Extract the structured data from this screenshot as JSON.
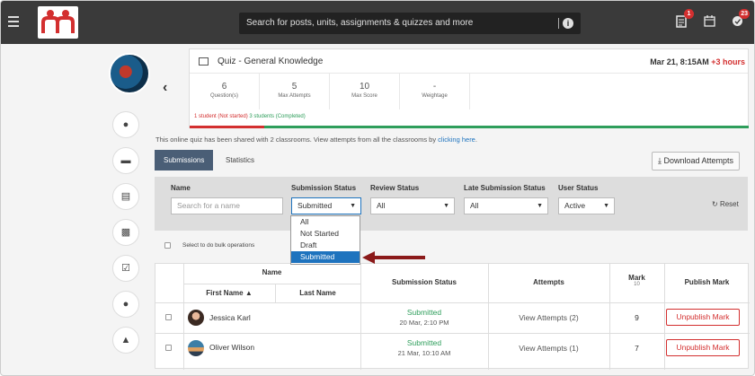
{
  "colors": {
    "accent": "#4a5e76",
    "danger": "#d32f2f",
    "success": "#2e9e5b",
    "link": "#1e73be"
  },
  "topbar": {
    "search_placeholder": "Search for posts, units, assignments & quizzes and more",
    "notifications_count": "1",
    "alerts_count": "23"
  },
  "quiz": {
    "title": "Quiz - General Knowledge",
    "date": "Mar 21, 8:15AM",
    "extra_hours": "+3 hours",
    "stats": [
      {
        "value": "6",
        "label": "Question(s)"
      },
      {
        "value": "5",
        "label": "Max Attempts"
      },
      {
        "value": "10",
        "label": "Max Score"
      },
      {
        "value": "-",
        "label": "Weightage"
      }
    ],
    "not_started": "1 student (Not started)",
    "completed": "3 students (Completed)",
    "progress_fraction": 0.25
  },
  "shared": {
    "text": "This online quiz has been shared with 2 classrooms. View attempts from all the classrooms by ",
    "link": "clicking here",
    "end": "."
  },
  "tabs": {
    "submissions": "Submissions",
    "statistics": "Statistics"
  },
  "download_label": "Download Attempts",
  "filters": {
    "name_label": "Name",
    "name_placeholder": "Search for a name",
    "submission_label": "Submission Status",
    "submission_value": "Submitted",
    "review_label": "Review Status",
    "review_value": "All",
    "late_label": "Late Submission Status",
    "late_value": "All",
    "user_label": "User Status",
    "user_value": "Active",
    "reset": "Reset"
  },
  "dropdown_options": [
    "All",
    "Not Started",
    "Draft",
    "Submitted"
  ],
  "bulk_label": "Select to do bulk operations",
  "table": {
    "headers": {
      "name": "Name",
      "first": "First Name",
      "last": "Last Name",
      "status": "Submission Status",
      "attempts": "Attempts",
      "mark": "Mark",
      "mark_sub": "10",
      "publish": "Publish Mark"
    },
    "rows": [
      {
        "first": "Jessica Karl",
        "last": "",
        "status": "Submitted",
        "date": "20 Mar, 2:10 PM",
        "attempts": "View Attempts (2)",
        "mark": "9",
        "action": "Unpublish Mark"
      },
      {
        "first": "Oliver Wilson",
        "last": "",
        "status": "Submitted",
        "date": "21 Mar, 10:10 AM",
        "attempts": "View Attempts (1)",
        "mark": "7",
        "action": "Unpublish Mark"
      }
    ]
  }
}
